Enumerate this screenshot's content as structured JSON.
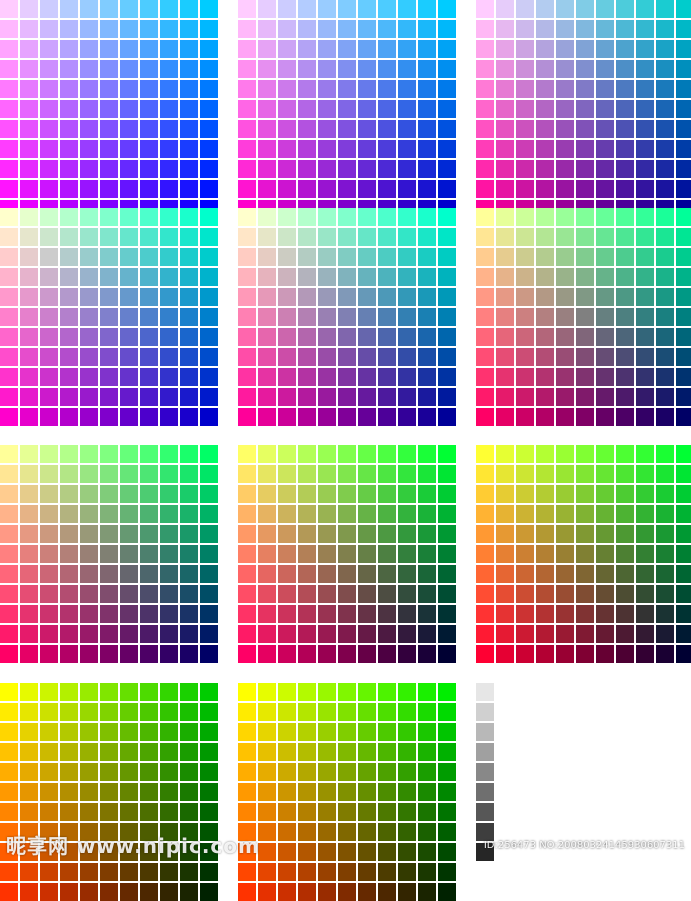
{
  "grid": {
    "rows": 11,
    "cols": 11,
    "panel_count": 11,
    "corner_colors": [
      {
        "top_left": "#ffccff",
        "top_right": "#00ccff",
        "bottom_left": "#ff00ff",
        "bottom_right": "#0000ff"
      },
      {
        "top_left": "#ffccff",
        "top_right": "#00ccff",
        "bottom_left": "#ff00cc",
        "bottom_right": "#0000cc"
      },
      {
        "top_left": "#ffccff",
        "top_right": "#00cccc",
        "bottom_left": "#ff0099",
        "bottom_right": "#000099"
      },
      {
        "top_left": "#ffffcc",
        "top_right": "#00ffcc",
        "bottom_left": "#ff00cc",
        "bottom_right": "#0000cc"
      },
      {
        "top_left": "#ffffcc",
        "top_right": "#00ffcc",
        "bottom_left": "#ff0099",
        "bottom_right": "#000099"
      },
      {
        "top_left": "#ffff99",
        "top_right": "#00ff99",
        "bottom_left": "#ff0066",
        "bottom_right": "#000066"
      },
      {
        "top_left": "#ffff99",
        "top_right": "#00ff66",
        "bottom_left": "#ff0066",
        "bottom_right": "#000066"
      },
      {
        "top_left": "#ffff66",
        "top_right": "#00ff33",
        "bottom_left": "#ff0066",
        "bottom_right": "#000033"
      },
      {
        "top_left": "#ffff33",
        "top_right": "#00ff33",
        "bottom_left": "#ff0033",
        "bottom_right": "#000033"
      },
      {
        "top_left": "#ffff00",
        "top_right": "#00cc00",
        "bottom_left": "#ff3300",
        "bottom_right": "#002200"
      },
      {
        "top_left": "#ffff00",
        "top_right": "#00ee00",
        "bottom_left": "#ff3300",
        "bottom_right": "#002200"
      }
    ]
  },
  "grayscale": {
    "values": [
      "#e6e6e6",
      "#d0d0d0",
      "#b8b8b8",
      "#a0a0a0",
      "#888888",
      "#6f6f6f",
      "#575757",
      "#3e3e3e",
      "#262626"
    ]
  },
  "watermark": {
    "brand": "昵享网 www.nipic.com",
    "id_text": "ID:256473 NO:20080324145930607311"
  }
}
